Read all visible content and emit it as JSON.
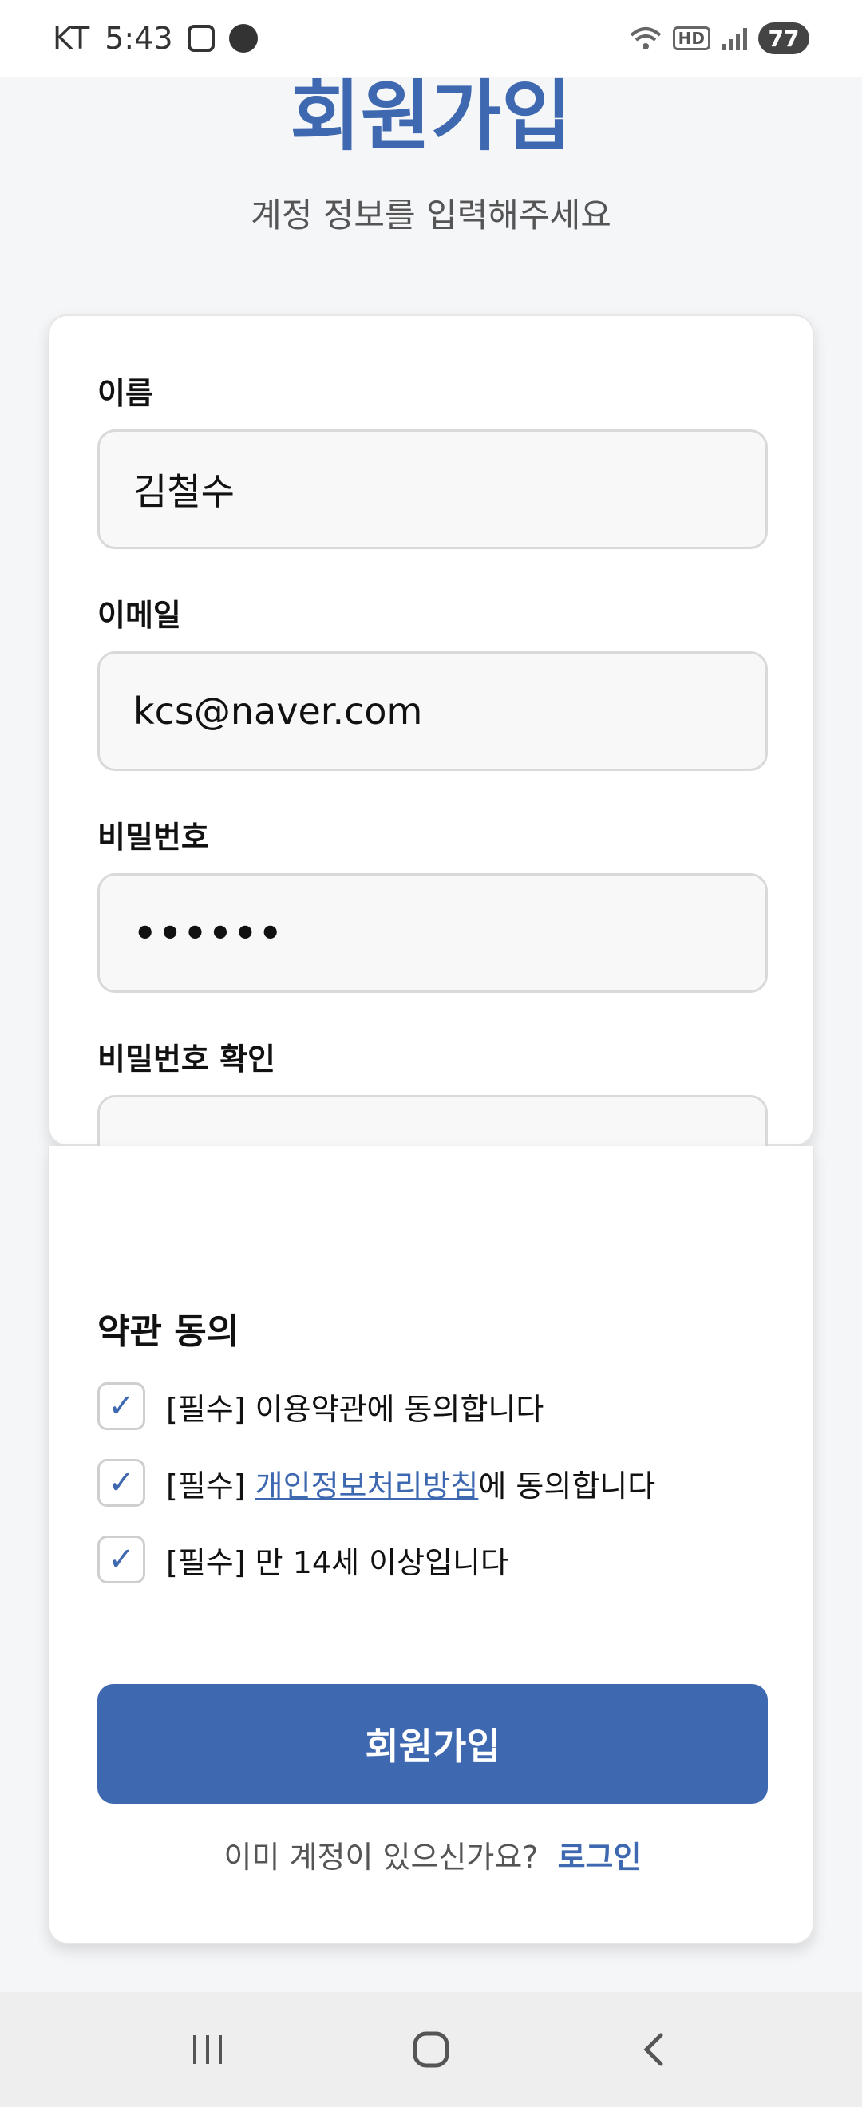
{
  "status_bar": {
    "carrier": "KT",
    "time": "5:43",
    "hd_label": "HD",
    "battery": "77"
  },
  "header": {
    "title": "회원가입",
    "subtitle": "계정 정보를 입력해주세요"
  },
  "form": {
    "name_label": "이름",
    "name_value": "김철수",
    "email_label": "이메일",
    "email_value": "kcs@naver.com",
    "password_label": "비밀번호",
    "password_value": "••••••",
    "password_confirm_label": "비밀번호 확인",
    "password_confirm_value": "••••••"
  },
  "agreements": {
    "title": "약관 동의",
    "check_mark": "✓",
    "items": [
      {
        "prefix": "[필수]",
        "text": "이용약관에 동의합니다",
        "checked": true
      },
      {
        "prefix": "[필수]",
        "link": "개인정보처리방침",
        "text": "에 동의합니다",
        "checked": true
      },
      {
        "prefix": "[필수]",
        "text": "만 14세 이상입니다",
        "checked": true
      }
    ]
  },
  "submit_label": "회원가입",
  "login_prompt": {
    "text": "이미 계정이 있으신가요?",
    "link": "로그인"
  },
  "nav_bar": {
    "items": [
      "recent-apps-icon",
      "home-icon",
      "back-icon"
    ]
  },
  "colors": {
    "accent": "#3e68b0"
  }
}
